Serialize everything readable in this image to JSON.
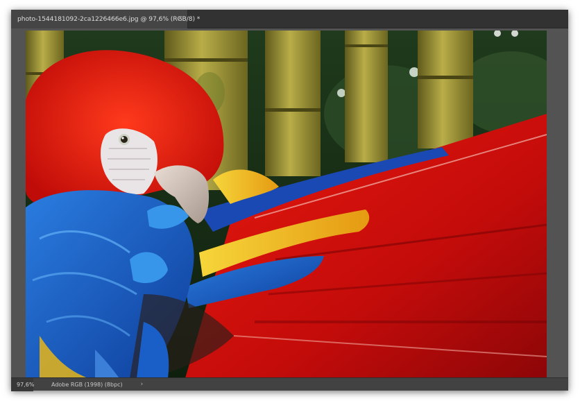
{
  "document_tab": {
    "title": "photo-1544181092-2ca1226466e6.jpg @ 97,6% (RGB/8) *",
    "close_glyph": "×",
    "close_icon": "close-icon"
  },
  "image": {
    "subject": "scarlet macaw preening feathers in front of bamboo"
  },
  "status_bar": {
    "zoom": "97,6%",
    "doc_info": "Adobe RGB (1998) (8bpc)",
    "arrow_glyph": "›",
    "arrow_icon": "chevron-right-icon"
  },
  "colors": {
    "panel": "#535353",
    "tabbar": "#323232",
    "active_tab": "#454545",
    "statusbar": "#424242",
    "parrot_red": "#d8140e",
    "parrot_blue": "#1a5fc8",
    "parrot_yellow": "#f2c21e",
    "bamboo": "#a59a3a"
  }
}
